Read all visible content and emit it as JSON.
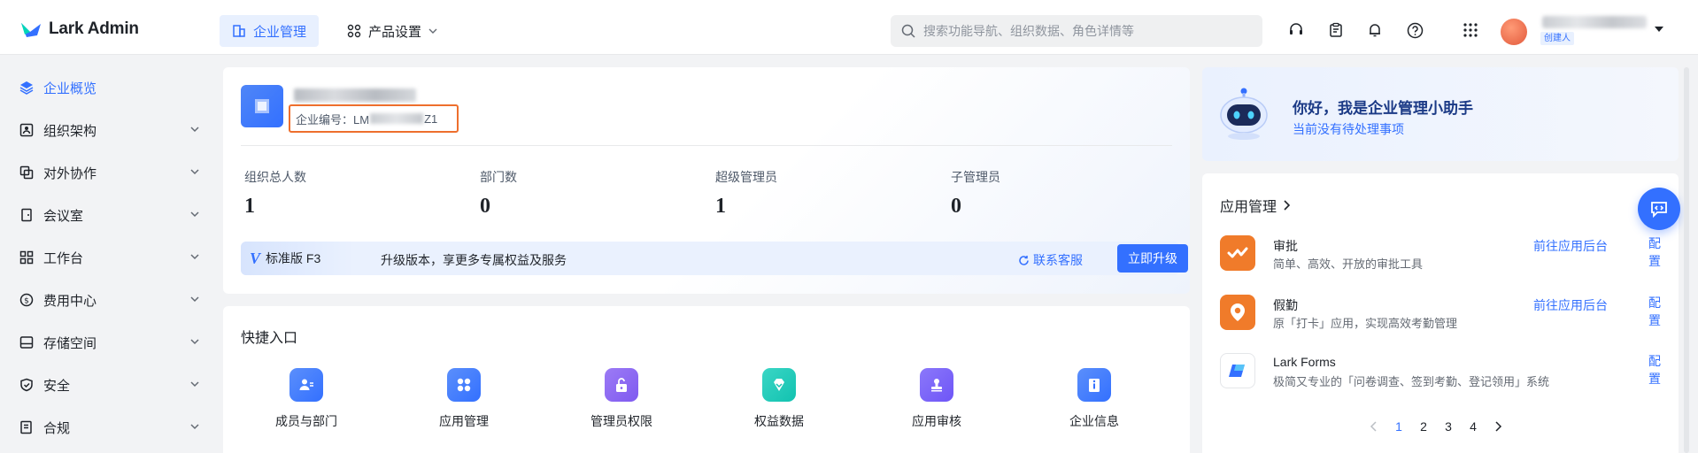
{
  "header": {
    "logo_text": "Lark Admin",
    "nav": [
      {
        "label": "企业管理",
        "active": true
      },
      {
        "label": "产品设置",
        "active": false
      }
    ],
    "search": {
      "placeholder": "搜索功能导航、组织数据、角色详情等"
    },
    "tools": [
      "headset-icon",
      "clipboard-icon",
      "bell-icon",
      "help-icon",
      "grid-icon"
    ],
    "user": {
      "badge": "创建人"
    }
  },
  "sidebar": {
    "items": [
      {
        "label": "企业概览",
        "icon": "layers-icon",
        "active": true
      },
      {
        "label": "组织架构",
        "icon": "org-icon"
      },
      {
        "label": "对外协作",
        "icon": "collab-icon"
      },
      {
        "label": "会议室",
        "icon": "door-icon"
      },
      {
        "label": "工作台",
        "icon": "apps-icon"
      },
      {
        "label": "费用中心",
        "icon": "dollar-icon"
      },
      {
        "label": "存储空间",
        "icon": "storage-icon"
      },
      {
        "label": "安全",
        "icon": "shield-icon"
      },
      {
        "label": "合规",
        "icon": "compliance-icon"
      }
    ]
  },
  "enterprise": {
    "id_label": "企业编号：LM",
    "id_suffix": "Z1",
    "stats": [
      {
        "label": "组织总人数",
        "value": "1"
      },
      {
        "label": "部门数",
        "value": "0"
      },
      {
        "label": "超级管理员",
        "value": "1"
      },
      {
        "label": "子管理员",
        "value": "0"
      }
    ],
    "upgrade": {
      "version_mark": "V",
      "version": "标准版 F3",
      "text": "升级版本，享更多专属权益及服务",
      "contact": "联系客服",
      "button": "立即升级"
    }
  },
  "quick": {
    "title": "快捷入口",
    "items": [
      {
        "label": "成员与部门",
        "icon": "member-icon",
        "color": "#3370ff"
      },
      {
        "label": "应用管理",
        "icon": "app-grid-icon",
        "color": "#3370ff"
      },
      {
        "label": "管理员权限",
        "icon": "unlock-icon",
        "color": "#7f5af0"
      },
      {
        "label": "权益数据",
        "icon": "diamond-icon",
        "color": "#12c2b0"
      },
      {
        "label": "应用审核",
        "icon": "stamp-icon",
        "color": "#6e55f7"
      },
      {
        "label": "企业信息",
        "icon": "info-icon",
        "color": "#3370ff"
      }
    ]
  },
  "assistant": {
    "title": "你好，我是企业管理小助手",
    "subtitle": "当前没有待处理事项"
  },
  "apps": {
    "title": "应用管理",
    "rows": [
      {
        "name": "审批",
        "desc": "简单、高效、开放的审批工具",
        "backend": "前往应用后台",
        "config": "配置",
        "color": "#f07b2a"
      },
      {
        "name": "假勤",
        "desc": "原「打卡」应用，实现高效考勤管理",
        "backend": "前往应用后台",
        "config": "配置",
        "color": "#f07b2a"
      },
      {
        "name": "Lark Forms",
        "desc": "极简又专业的「问卷调查、签到考勤、登记领用」系统",
        "backend": "",
        "config": "配置",
        "color": "#3370ff"
      }
    ],
    "pages": [
      "1",
      "2",
      "3",
      "4"
    ]
  }
}
